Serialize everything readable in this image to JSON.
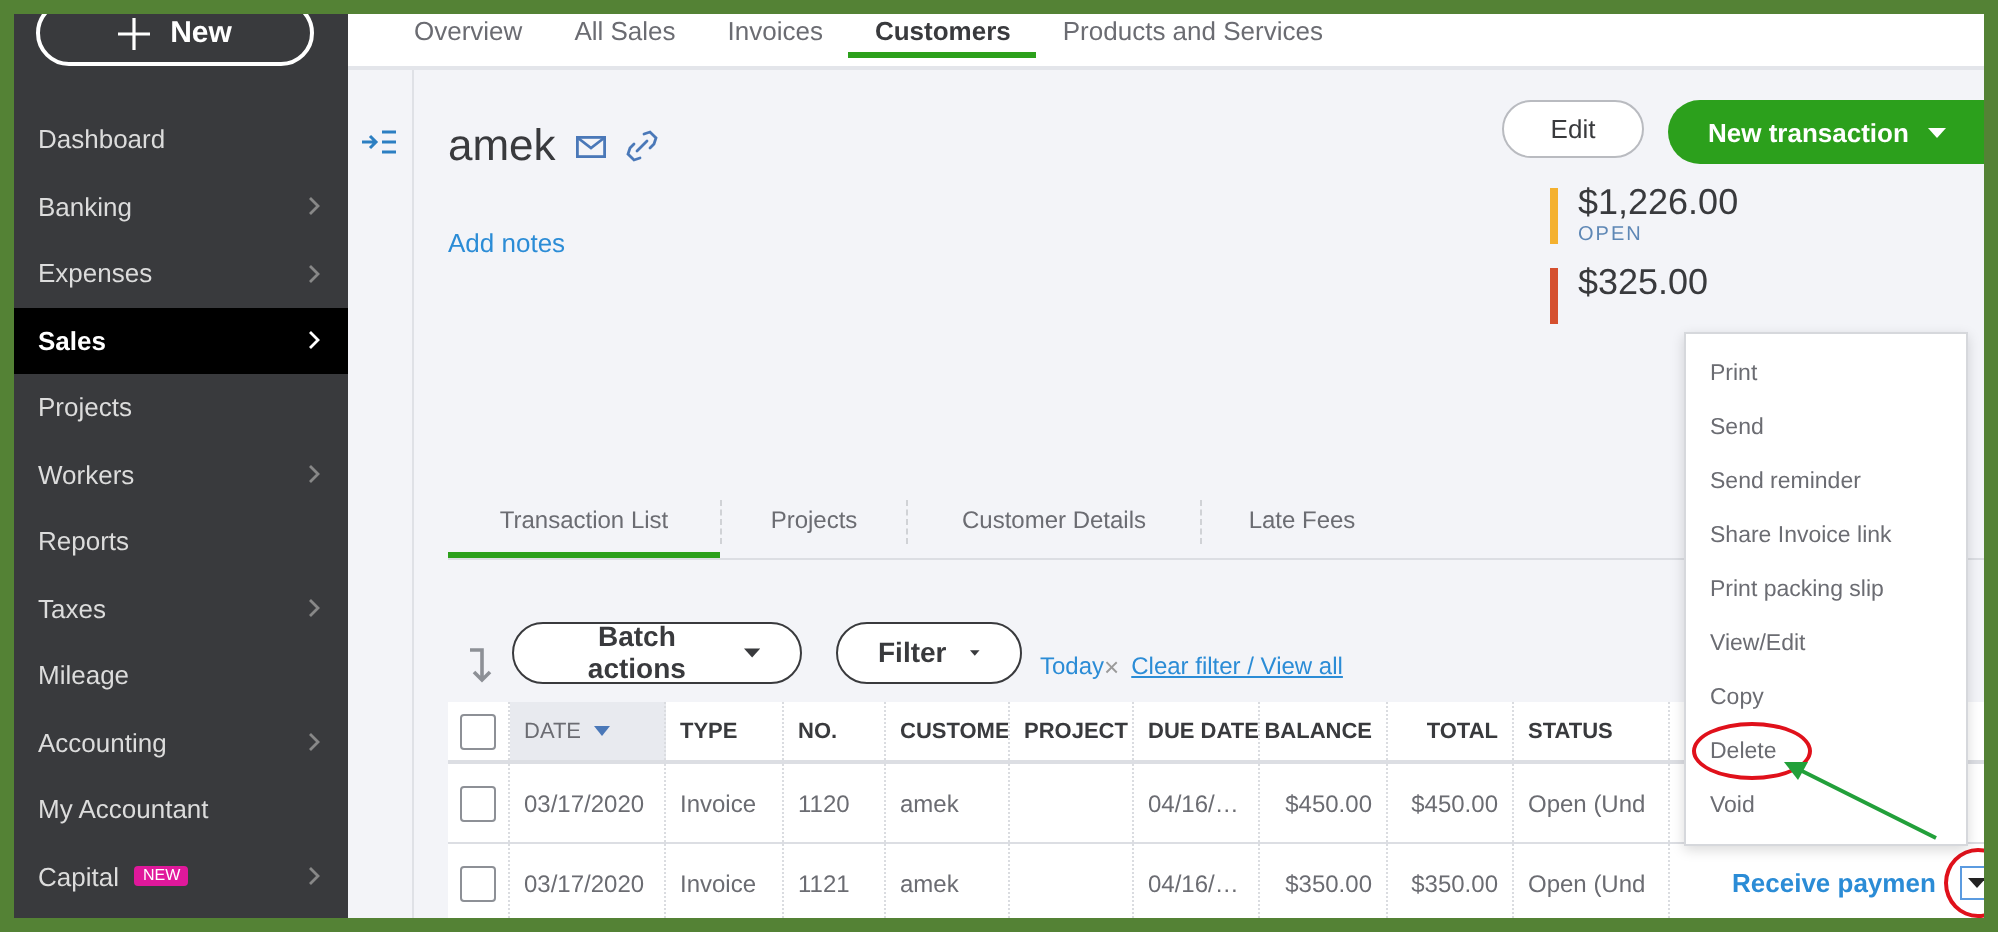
{
  "sidebar": {
    "new_button": "New",
    "items": [
      {
        "label": "Dashboard",
        "selected": false,
        "expandable": false
      },
      {
        "label": "Banking",
        "selected": false,
        "expandable": true
      },
      {
        "label": "Expenses",
        "selected": false,
        "expandable": true
      },
      {
        "label": "Sales",
        "selected": true,
        "expandable": true
      },
      {
        "label": "Projects",
        "selected": false,
        "expandable": false
      },
      {
        "label": "Workers",
        "selected": false,
        "expandable": true
      },
      {
        "label": "Reports",
        "selected": false,
        "expandable": false
      },
      {
        "label": "Taxes",
        "selected": false,
        "expandable": true
      },
      {
        "label": "Mileage",
        "selected": false,
        "expandable": false
      },
      {
        "label": "Accounting",
        "selected": false,
        "expandable": true
      },
      {
        "label": "My Accountant",
        "selected": false,
        "expandable": false
      },
      {
        "label": "Capital",
        "selected": false,
        "expandable": true,
        "badge": "NEW"
      }
    ]
  },
  "top_tabs": [
    {
      "label": "Overview",
      "selected": false
    },
    {
      "label": "All Sales",
      "selected": false
    },
    {
      "label": "Invoices",
      "selected": false
    },
    {
      "label": "Customers",
      "selected": true
    },
    {
      "label": "Products and Services",
      "selected": false
    }
  ],
  "customer": {
    "name": "amek",
    "add_notes": "Add notes",
    "edit_button": "Edit",
    "new_transaction_button": "New transaction"
  },
  "balances": [
    {
      "amount": "$1,226.00",
      "label": "OPEN",
      "color": "#f4b12f"
    },
    {
      "amount": "$325.00",
      "color": "#d5502f"
    }
  ],
  "sub_tabs": [
    {
      "label": "Transaction List",
      "selected": true
    },
    {
      "label": "Projects",
      "selected": false
    },
    {
      "label": "Customer Details",
      "selected": false
    },
    {
      "label": "Late Fees",
      "selected": false
    }
  ],
  "toolbar": {
    "batch_actions": "Batch actions",
    "filter": "Filter",
    "filter_chip": "Today",
    "filter_chip_remove": "×",
    "clear_filter": "Clear filter / View all"
  },
  "table": {
    "all_checked": false,
    "columns": [
      {
        "label": "DATE",
        "sorted": true,
        "kind": "text"
      },
      {
        "label": "TYPE",
        "sorted": false,
        "kind": "text"
      },
      {
        "label": "NO.",
        "sorted": false,
        "kind": "text"
      },
      {
        "label": "CUSTOME",
        "sorted": false,
        "kind": "text"
      },
      {
        "label": "PROJECT",
        "sorted": false,
        "kind": "text"
      },
      {
        "label": "DUE DATE",
        "sorted": false,
        "kind": "text"
      },
      {
        "label": "BALANCE",
        "sorted": false,
        "kind": "amount"
      },
      {
        "label": "TOTAL",
        "sorted": false,
        "kind": "amount"
      },
      {
        "label": "STATUS",
        "sorted": false,
        "kind": "text"
      }
    ],
    "rows": [
      {
        "checked": false,
        "cells": [
          "03/17/2020",
          "Invoice",
          "1120",
          "amek",
          "",
          "04/16/…",
          "$450.00",
          "$450.00",
          "Open (Und"
        ]
      },
      {
        "checked": false,
        "cells": [
          "03/17/2020",
          "Invoice",
          "1121",
          "amek",
          "",
          "04/16/…",
          "$350.00",
          "$350.00",
          "Open (Und"
        ],
        "action": "Receive paymen",
        "menu_open": true,
        "highlighted": true
      }
    ]
  },
  "row_menu": {
    "items": [
      {
        "label": "Print",
        "highlighted": false
      },
      {
        "label": "Send",
        "highlighted": false
      },
      {
        "label": "Send reminder",
        "highlighted": false
      },
      {
        "label": "Share Invoice link",
        "highlighted": false
      },
      {
        "label": "Print packing slip",
        "highlighted": false
      },
      {
        "label": "View/Edit",
        "highlighted": false
      },
      {
        "label": "Copy",
        "highlighted": false
      },
      {
        "label": "Delete",
        "highlighted": true
      },
      {
        "label": "Void",
        "highlighted": false
      }
    ]
  }
}
